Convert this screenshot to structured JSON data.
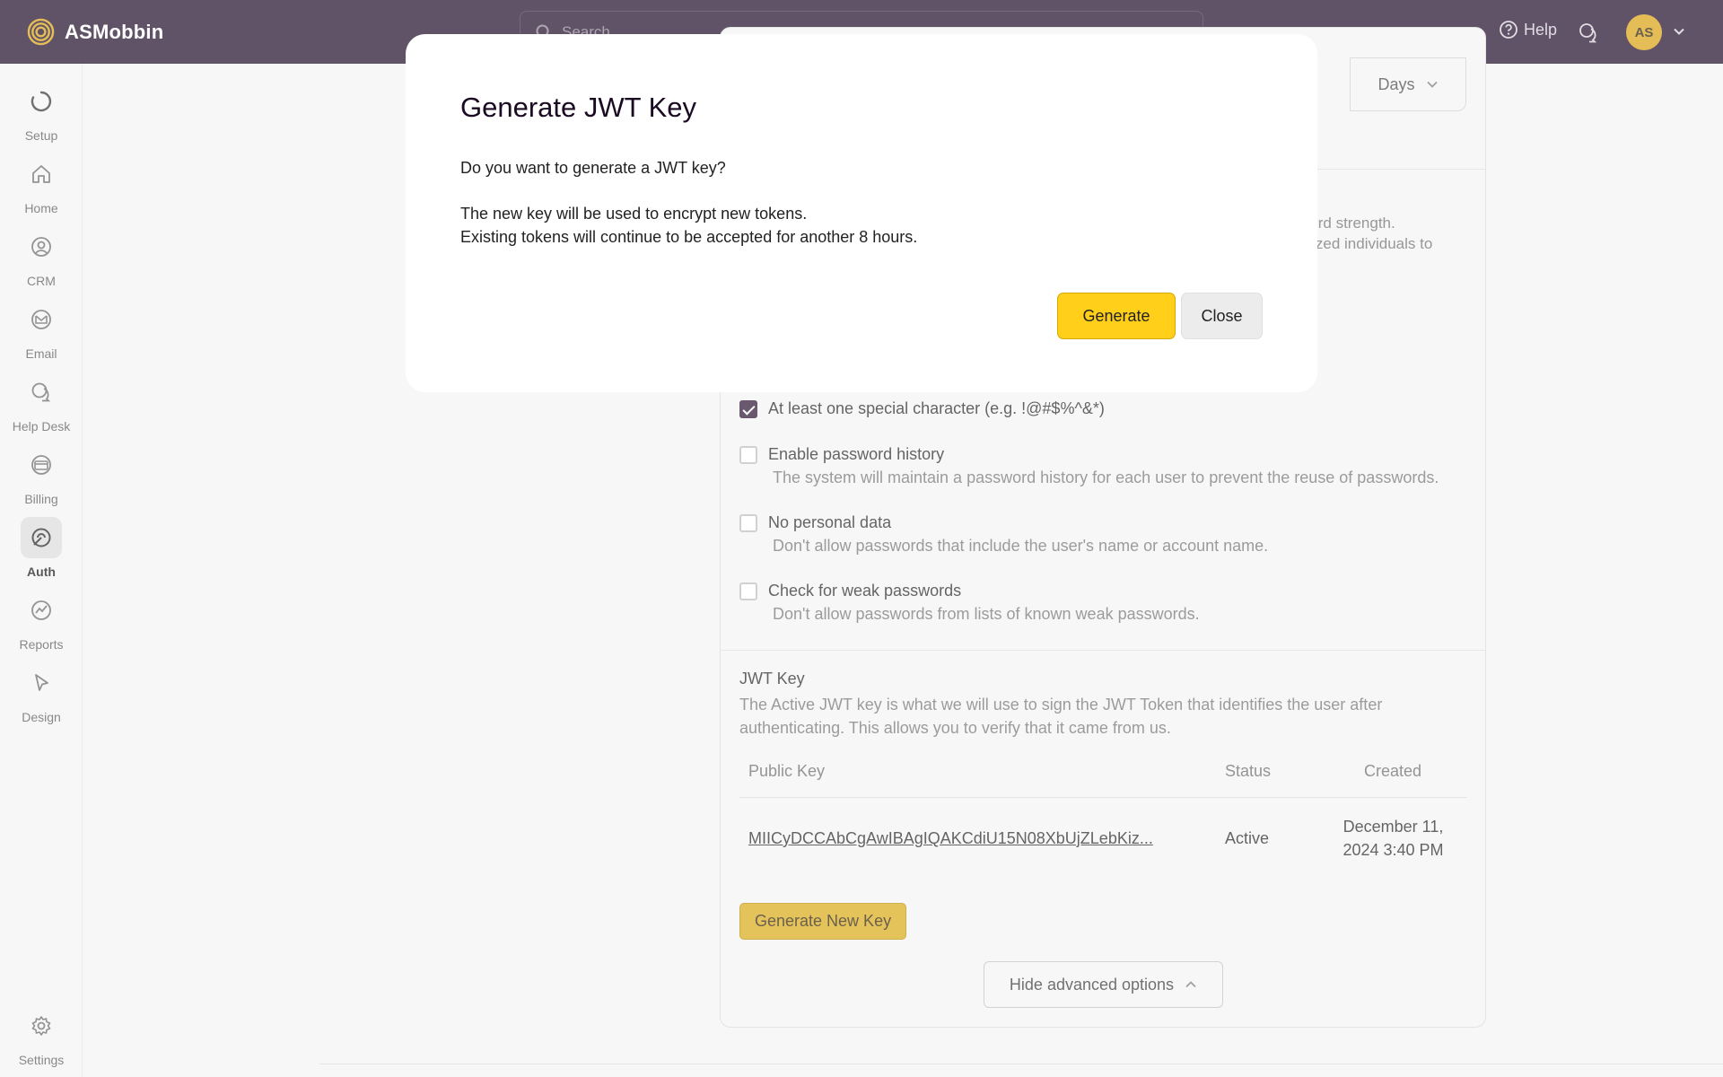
{
  "app": {
    "name": "ASMobbin"
  },
  "header": {
    "search_placeholder": "Search",
    "help_label": "Help",
    "avatar_initials": "AS"
  },
  "sidebar": {
    "items": [
      {
        "label": "Setup",
        "icon": "loader-icon",
        "active": false
      },
      {
        "label": "Home",
        "icon": "home-icon",
        "active": false
      },
      {
        "label": "CRM",
        "icon": "user-circle-icon",
        "active": false
      },
      {
        "label": "Email",
        "icon": "mail-icon",
        "active": false
      },
      {
        "label": "Help Desk",
        "icon": "chat-bubbles-icon",
        "active": false
      },
      {
        "label": "Billing",
        "icon": "credit-card-icon",
        "active": false
      },
      {
        "label": "Auth",
        "icon": "auth-icon",
        "active": true
      },
      {
        "label": "Reports",
        "icon": "chart-line-icon",
        "active": false
      },
      {
        "label": "Design",
        "icon": "cursor-icon",
        "active": false
      }
    ],
    "settings_label": "Settings"
  },
  "background": {
    "days_label": "Days",
    "password_strength_partial": "word strength.",
    "password_strength_partial2": "orized individuals to",
    "options": [
      {
        "title": "At least one special character (e.g. !@#$%^&*)",
        "desc": "",
        "checked": true
      },
      {
        "title": "Enable password history",
        "desc": "The system will maintain a password history for each user to prevent the reuse of passwords.",
        "checked": false
      },
      {
        "title": "No personal data",
        "desc": "Don't allow passwords that include the user's name or account name.",
        "checked": false
      },
      {
        "title": "Check for weak passwords",
        "desc": "Don't allow passwords from lists of known weak passwords.",
        "checked": false
      }
    ],
    "jwt": {
      "title": "JWT Key",
      "desc": "The Active JWT key is what we will use to sign the JWT Token that identifies the user after authenticating. This allows you to verify that it came from us.",
      "columns": [
        "Public Key",
        "Status",
        "Created"
      ],
      "rows": [
        {
          "public_key": "MIICyDCCAbCgAwIBAgIQAKCdiU15N08XbUjZLebKiz...",
          "status": "Active",
          "created_line1": "December 11,",
          "created_line2": "2024 3:40 PM"
        }
      ],
      "generate_new_label": "Generate New Key",
      "hide_advanced_label": "Hide advanced options"
    }
  },
  "modal": {
    "title": "Generate JWT Key",
    "question": "Do you want to generate a JWT key?",
    "line1": "The new key will be used to encrypt new tokens.",
    "line2": "Existing tokens will continue to be accepted for another 8 hours.",
    "generate_label": "Generate",
    "close_label": "Close"
  },
  "colors": {
    "topbar": "#1e0a26",
    "accent": "#ffcf1a",
    "avatar": "#d8a10f"
  }
}
